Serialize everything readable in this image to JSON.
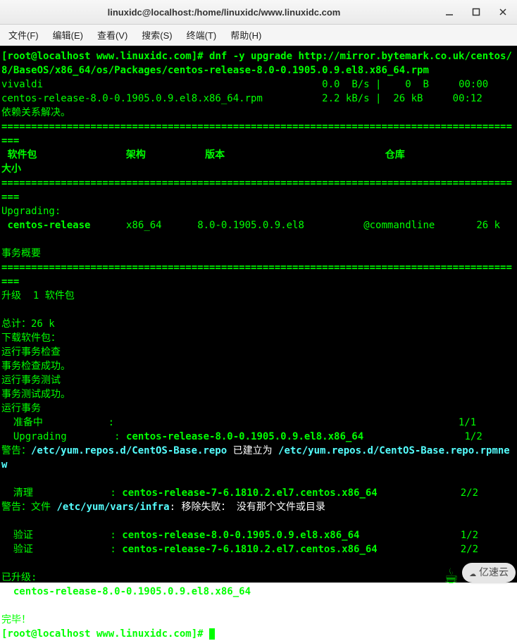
{
  "window": {
    "title": "linuxidc@localhost:/home/linuxidc/www.linuxidc.com"
  },
  "menu": {
    "file": "文件(F)",
    "edit": "编辑(E)",
    "view": "查看(V)",
    "search": "搜索(S)",
    "terminal": "终端(T)",
    "help": "帮助(H)"
  },
  "term": {
    "prompt_user_host": "[root@localhost www.linuxidc.com]#",
    "cmd": "dnf -y upgrade http://mirror.bytemark.co.uk/centos/8/BaseOS/x86_64/os/Packages/centos-release-8.0-0.1905.0.9.el8.x86_64.rpm",
    "dl_row1_name": "vivaldi",
    "dl_row1_rate": "0.0  B/s",
    "dl_row1_size": "0  B",
    "dl_row1_time": "00:00",
    "dl_row2_name": "centos-release-8.0-0.1905.0.9.el8.x86_64.rpm",
    "dl_row2_rate": "2.2 kB/s",
    "dl_row2_size": "26 kB",
    "dl_row2_time": "00:12",
    "deps_resolved": "依赖关系解决。",
    "dbl_line": "=========================================================================================",
    "hdr_pkg": "软件包",
    "hdr_arch": "架构",
    "hdr_ver": "版本",
    "hdr_repo": "仓库",
    "hdr_size": "大小",
    "upgrading": "Upgrading:",
    "pkg_name": "centos-release",
    "pkg_arch": "x86_64",
    "pkg_ver": "8.0-0.1905.0.9.el8",
    "pkg_repo": "@commandline",
    "pkg_size": "26 k",
    "txn_summary": "事务概要",
    "upgrade_count": "升级  1 软件包",
    "total_size": "总计：26 k",
    "downloading": "下载软件包：",
    "run_check": "运行事务检查",
    "check_ok": "事务检查成功。",
    "run_test": "运行事务测试",
    "test_ok": "事务测试成功。",
    "run_txn": "运行事务",
    "prepare_label": "准备中",
    "prepare_frac": "1/1",
    "upg_label": "Upgrading",
    "upg_pkg": "centos-release-8.0-0.1905.0.9.el8.x86_64",
    "upg_frac": "1/2",
    "warn1_prefix": "警告：",
    "warn1_path1": "/etc/yum.repos.d/CentOS-Base.repo",
    "warn1_mid": " 已建立为 ",
    "warn1_path2": "/etc/yum.repos.d/CentOS-Base.repo.rpmnew",
    "clean_label": "清理",
    "clean_pkg": "centos-release-7-6.1810.2.el7.centos.x86_64",
    "clean_frac": "2/2",
    "warn2_prefix": "警告：文件 ",
    "warn2_path": "/etc/yum/vars/infra",
    "warn2_suffix": ": 移除失败： 没有那个文件或目录",
    "verify_label": "验证",
    "verify1_pkg": "centos-release-8.0-0.1905.0.9.el8.x86_64",
    "verify1_frac": "1/2",
    "verify2_pkg": "centos-release-7-6.1810.2.el7.centos.x86_64",
    "verify2_frac": "2/2",
    "upgraded": "已升级:",
    "upgraded_pkg": "centos-release-8.0-0.1905.0.9.el8.x86_64",
    "done": "完毕！"
  },
  "watermark": {
    "brand": "亿速云"
  }
}
